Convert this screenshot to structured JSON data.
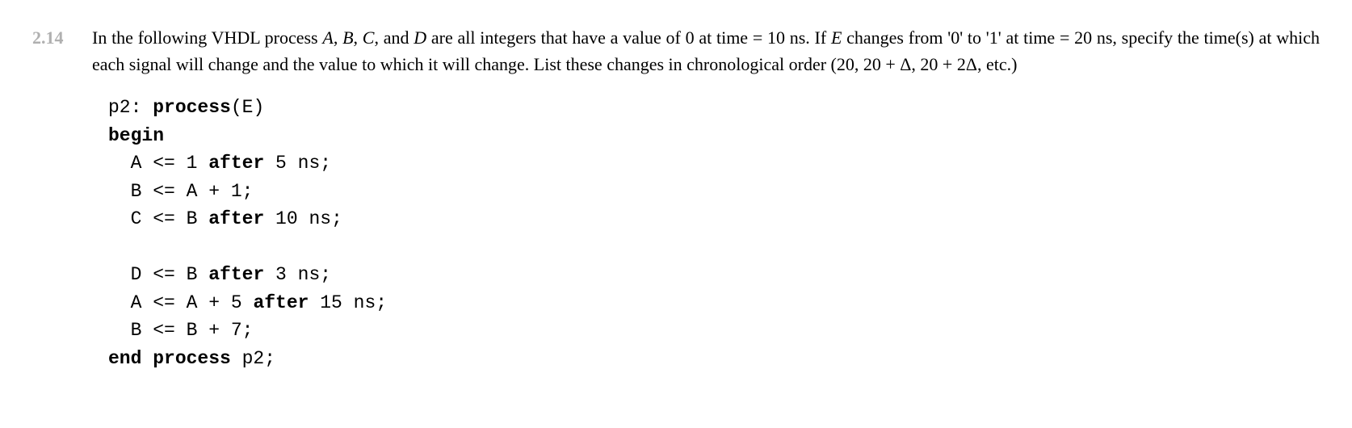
{
  "problem": {
    "number": "2.14",
    "text_part1": "In the following VHDL process ",
    "var_A": "A",
    "comma1": ", ",
    "var_B": "B",
    "comma2": ", ",
    "var_C": "C",
    "comma3": ", and ",
    "var_D": "D",
    "text_part2": " are all integers that have a value of 0 at time = 10 ns. If ",
    "var_E": "E",
    "text_part3": " changes from '0' to '1' at time = 20 ns, specify the time(s) at which each signal will change and the value to which it will change. List these changes in chronological order (20, 20 + Δ, 20 + 2Δ, etc.)"
  },
  "code": {
    "line1_a": "p2: ",
    "line1_b": "process",
    "line1_c": "(E)",
    "line2": "begin",
    "line3_a": "  A <= 1 ",
    "line3_b": "after",
    "line3_c": " 5 ns;",
    "line4": "  B <= A + 1;",
    "line5_a": "  C <= B ",
    "line5_b": "after",
    "line5_c": " 10 ns;",
    "line6_a": "  D <= B ",
    "line6_b": "after",
    "line6_c": " 3 ns;",
    "line7_a": "  A <= A + 5 ",
    "line7_b": "after",
    "line7_c": " 15 ns;",
    "line8": "  B <= B + 7;",
    "line9_a": "end process",
    "line9_b": " p2;"
  }
}
